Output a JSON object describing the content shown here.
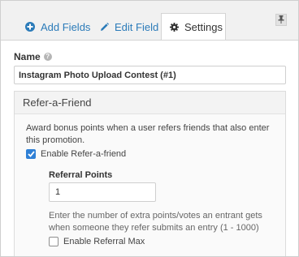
{
  "tabs": [
    {
      "label": "Add Fields",
      "icon": "plus-circle-icon"
    },
    {
      "label": "Edit Field",
      "icon": "pencil-icon"
    },
    {
      "label": "Settings",
      "icon": "gear-icon"
    }
  ],
  "active_tab": "Settings",
  "name": {
    "label": "Name",
    "value": "Instagram Photo Upload Contest (#1)"
  },
  "refer": {
    "title": "Refer-a-Friend",
    "description": "Award bonus points when a user refers friends that also enter this promotion.",
    "enable_label": "Enable Refer-a-friend",
    "enable_checked": true,
    "points_label": "Referral Points",
    "points_value": "1",
    "points_help": "Enter the number of extra points/votes an entrant gets when someone they refer submits an entry (1 - 1000)",
    "max_label": "Enable Referral Max",
    "max_checked": false
  },
  "colors": {
    "link": "#2b7bb9",
    "checkbox": "#2f80d6"
  }
}
